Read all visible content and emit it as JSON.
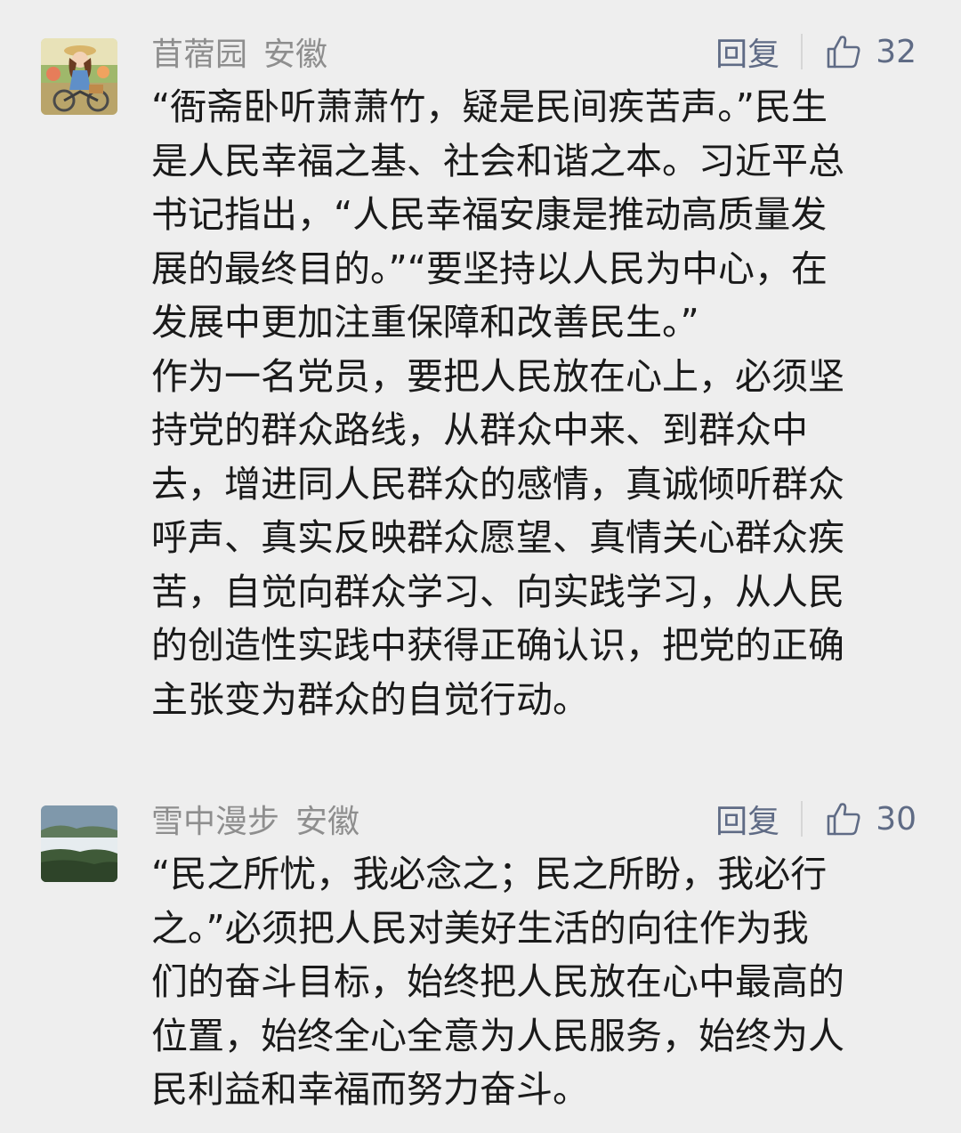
{
  "comments": [
    {
      "username": "苜蓿园",
      "location": "安徽",
      "reply_label": "回复",
      "like_count": "32",
      "avatar": "avatar-girl-on-bicycle",
      "lines": [
        "“衙斋卧听萧萧竹，疑是民间疾苦声。”民生",
        "是人民幸福之基、社会和谐之本。习近平总",
        "书记指出，“人民幸福安康是推动高质量发",
        "展的最终目的。”“要坚持以人民为中心，在",
        "发展中更加注重保障和改善民生。”",
        "作为一名党员，要把人民放在心上，必须坚",
        "持党的群众路线，从群众中来、到群众中",
        "去，增进同人民群众的感情，真诚倾听群众",
        "呼声、真实反映群众愿望、真情关心群众疾",
        "苦，自觉向群众学习、向实践学习，从人民",
        "的创造性实践中获得正确认识，把党的正确",
        "主张变为群众的自觉行动。"
      ]
    },
    {
      "username": "雪中漫步",
      "location": "安徽",
      "reply_label": "回复",
      "like_count": "30",
      "avatar": "avatar-misty-mountains",
      "lines": [
        "“民之所忧，我必念之；民之所盼，我必行",
        "之。”必须把人民对美好生活的向往作为我",
        "们的奋斗目标，始终把人民放在心中最高的",
        "位置，始终全心全意为人民服务，始终为人",
        "民利益和幸福而努力奋斗。"
      ]
    }
  ],
  "colors": {
    "background": "#eeeeee",
    "text": "#1a1a1a",
    "meta": "#8e8e8e",
    "action": "#5f6b85"
  }
}
